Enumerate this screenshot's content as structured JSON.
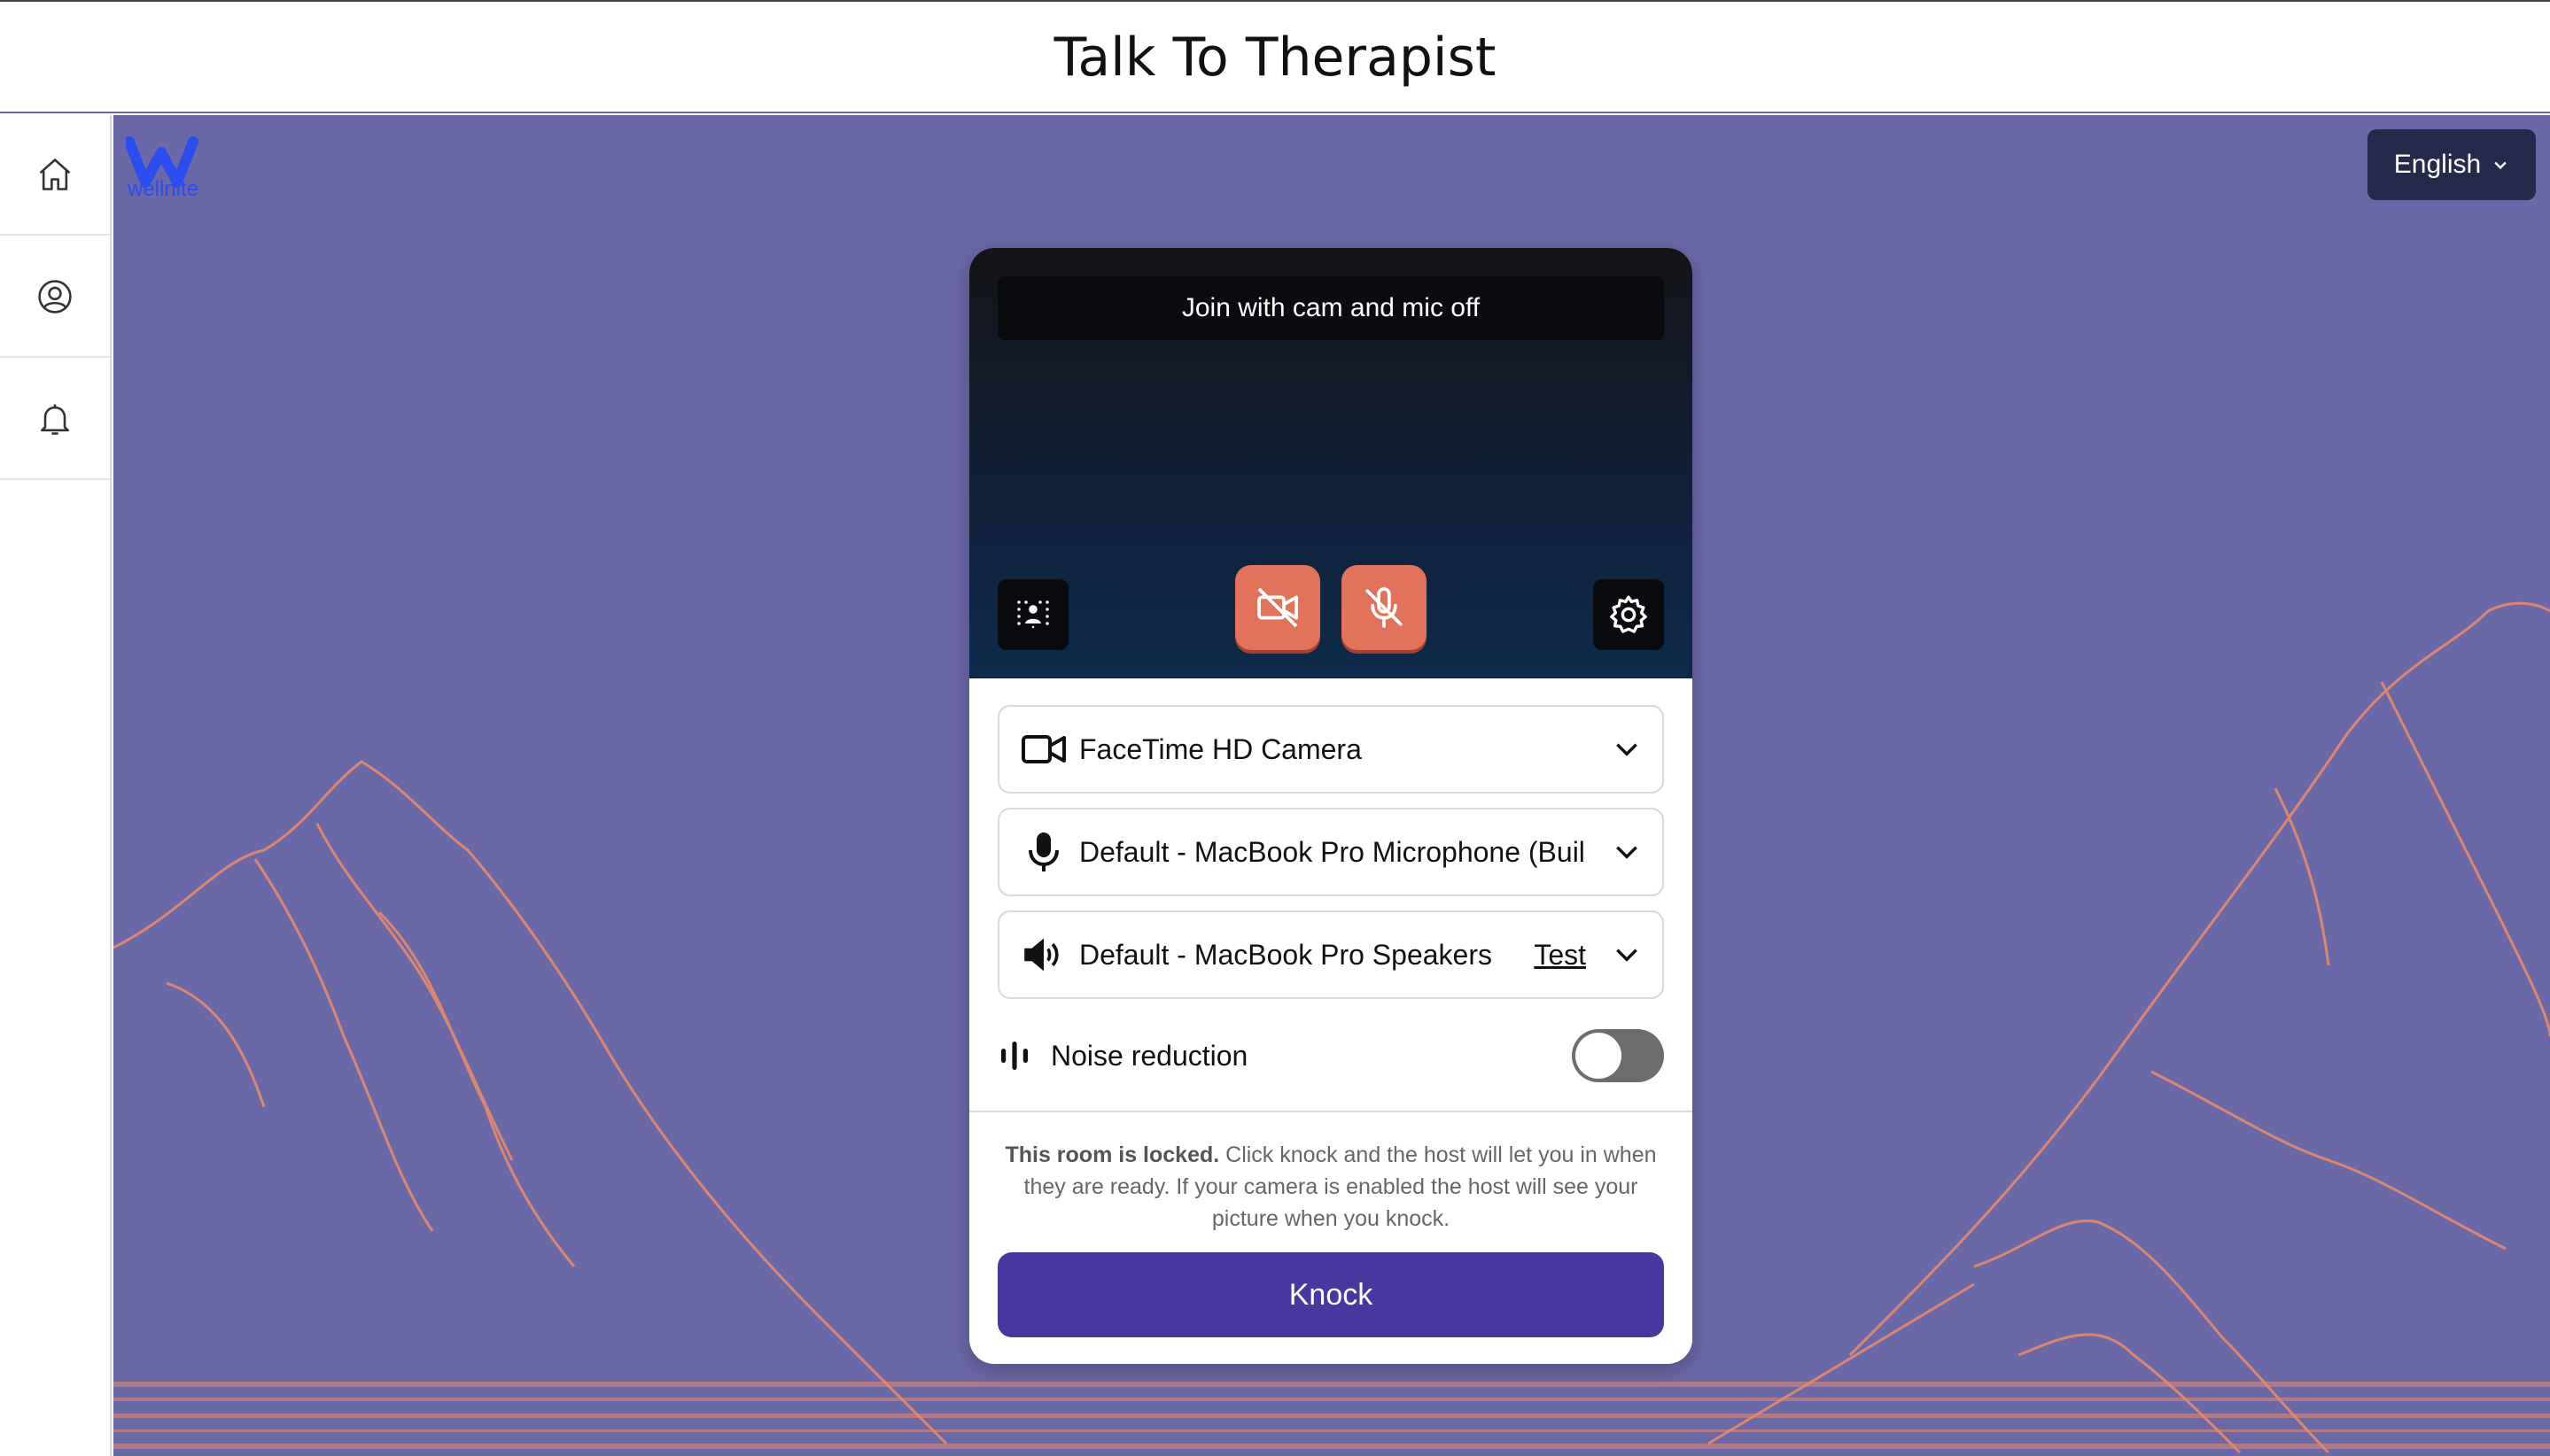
{
  "header": {
    "title": "Talk To Therapist"
  },
  "sidebar": {
    "items": [
      {
        "icon": "home-icon"
      },
      {
        "icon": "user-circle-icon"
      },
      {
        "icon": "bell-icon"
      }
    ]
  },
  "brand": {
    "logo_text": "wellnite",
    "color": "#2a4ef0"
  },
  "language": {
    "selected": "English"
  },
  "preview": {
    "join_text": "Join with cam and mic off",
    "camera_state": "off",
    "mic_state": "off"
  },
  "devices": {
    "camera": "FaceTime HD Camera",
    "microphone": "Default - MacBook Pro Microphone (Buil",
    "speakers": "Default - MacBook Pro Speakers",
    "test_label": "Test"
  },
  "noise": {
    "label": "Noise reduction",
    "enabled": false
  },
  "lock_notice": {
    "bold": "This room is locked.",
    "text": " Click knock and the host will let you in when they are ready. If your camera is enabled the host will see your picture when you knock."
  },
  "knock": {
    "label": "Knock"
  },
  "colors": {
    "background": "#6b68a8",
    "accent_button": "#46389f",
    "media_off": "#e2735a",
    "language_button": "#262a4a"
  }
}
